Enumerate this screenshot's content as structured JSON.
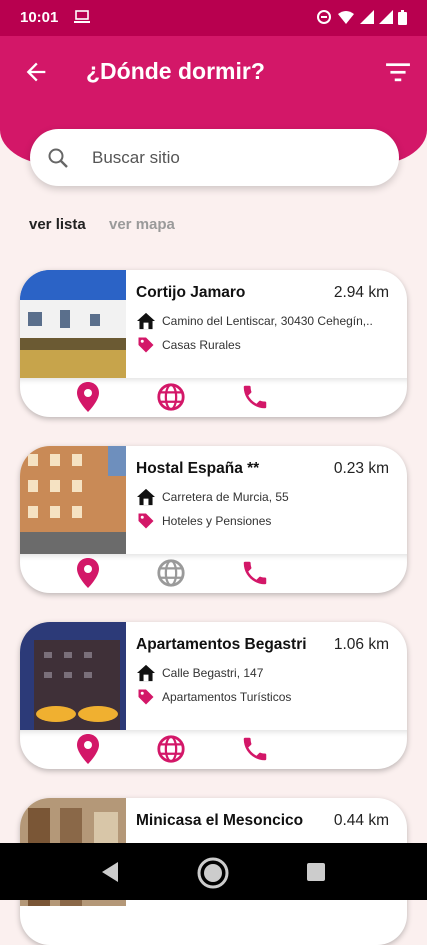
{
  "status": {
    "time": "10:01"
  },
  "header": {
    "title": "¿Dónde dormir?"
  },
  "search": {
    "placeholder": "Buscar sitio",
    "value": ""
  },
  "tabs": {
    "list": "ver lista",
    "map": "ver mapa",
    "active": "list"
  },
  "colors": {
    "brand": "#d31768",
    "status_bar": "#b8004f",
    "background": "#fbf0ef",
    "disabled_icon": "#9a9a9a"
  },
  "places": [
    {
      "name": "Cortijo Jamaro",
      "distance": "2.94 km",
      "address": "Camino del Lentiscar, 30430 Cehegín,..",
      "category": "Casas Rurales",
      "web_available": true,
      "image": "rural house photo"
    },
    {
      "name": "Hostal España **",
      "distance": "0.23 km",
      "address": "Carretera de Murcia, 55",
      "category": "Hoteles y Pensiones",
      "web_available": false,
      "image": "brick building photo"
    },
    {
      "name": "Apartamentos Begastri",
      "distance": "1.06 km",
      "address": "Calle Begastri, 147",
      "category": "Apartamentos Turísticos",
      "web_available": true,
      "image": "building at dusk photo"
    },
    {
      "name": "Minicasa el Mesoncico",
      "distance": "0.44 km",
      "address": "",
      "category": "",
      "web_available": true,
      "image": "interior photo"
    }
  ]
}
